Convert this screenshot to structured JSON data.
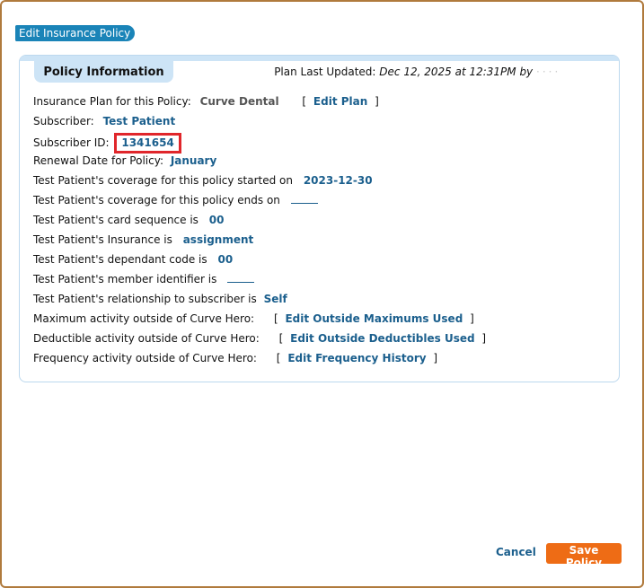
{
  "dialog": {
    "title": "Edit Insurance Policy"
  },
  "panel": {
    "tab_label": "Policy Information",
    "last_updated_label": "Plan Last Updated:",
    "last_updated_value": "Dec 12, 2025 at 12:31PM by",
    "rows": {
      "plan": {
        "label": "Insurance Plan for this Policy:",
        "value": "Curve Dental",
        "link": "Edit Plan"
      },
      "subscriber": {
        "label": "Subscriber:",
        "value": "Test Patient"
      },
      "subscriber_id": {
        "label": "Subscriber ID:",
        "value": "1341654"
      },
      "renewal": {
        "label": "Renewal Date for Policy:",
        "value": "January"
      },
      "coverage_start": {
        "label": "Test Patient's coverage for this policy started on",
        "value": "2023-12-30"
      },
      "coverage_end": {
        "label": "Test Patient's coverage for this policy ends on"
      },
      "card_sequence": {
        "label": "Test Patient's card sequence is",
        "value": "00"
      },
      "insurance": {
        "label": "Test Patient's Insurance is",
        "value": "assignment"
      },
      "dependant_code": {
        "label": "Test Patient's dependant code is",
        "value": "00"
      },
      "member_identifier": {
        "label": "Test Patient's member identifier is"
      },
      "relationship": {
        "label": "Test Patient's relationship to subscriber is",
        "value": "Self"
      },
      "maximum": {
        "label": "Maximum activity outside of Curve Hero:",
        "link": "Edit Outside Maximums Used"
      },
      "deductible": {
        "label": "Deductible activity outside of Curve Hero:",
        "link": "Edit Outside Deductibles Used"
      },
      "frequency": {
        "label": "Frequency activity outside of Curve Hero:",
        "link": "Edit Frequency History"
      }
    }
  },
  "footer": {
    "cancel_label": "Cancel",
    "save_label": "Save Policy"
  },
  "colors": {
    "accent": "#1a84b8",
    "link": "#1b5f8d",
    "save_button": "#ee6c15",
    "highlight": "#e0262b"
  }
}
